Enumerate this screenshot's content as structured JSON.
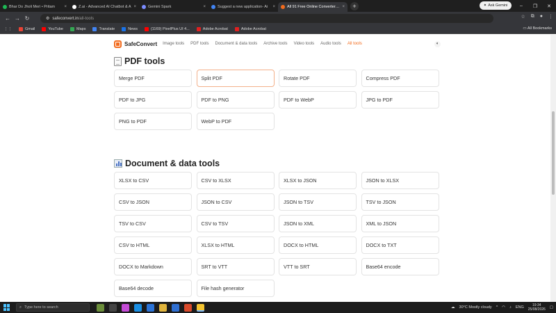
{
  "browser": {
    "tabs": [
      {
        "title": "Bhar Do Jholi Meri • Pritam",
        "favicon_color": "#1db954",
        "active": false
      },
      {
        "title": "Z.ai - Advanced AI Chatbot & A",
        "favicon_color": "#ffffff",
        "active": false
      },
      {
        "title": "Gemini Spark",
        "favicon_color": "#7b8cff",
        "active": false
      },
      {
        "title": "Suggest a new application- Ai",
        "favicon_color": "#4285f4",
        "active": false
      },
      {
        "title": "All 91 Free Online Converter To",
        "favicon_color": "#f26b1d",
        "active": true
      }
    ],
    "tab_close": "×",
    "new_tab": "+",
    "ask_gemini": "Ask Gemini",
    "window_controls": [
      "–",
      "❐",
      "✕"
    ],
    "url_domain": "safeconvert.in",
    "url_path": "/all-tools",
    "bookmarks": [
      {
        "label": "Gmail",
        "color": "#ea4335"
      },
      {
        "label": "YouTube",
        "color": "#ff0000"
      },
      {
        "label": "Maps",
        "color": "#34a853"
      },
      {
        "label": "Translate",
        "color": "#4285f4"
      },
      {
        "label": "News",
        "color": "#1a73e8"
      },
      {
        "label": "(1169) PixelPlus UI 4...",
        "color": "#ff0000"
      },
      {
        "label": "Adobe Acrobat",
        "color": "#e02020"
      },
      {
        "label": "Adobe Acrobat",
        "color": "#e02020"
      }
    ],
    "all_bookmarks": "All Bookmarks"
  },
  "site": {
    "brand": "SafeConvert",
    "brand_color": "#f26b1d",
    "nav": [
      "Image tools",
      "PDF tools",
      "Document & data tools",
      "Archive tools",
      "Video tools",
      "Audio tools",
      "All tools"
    ],
    "active_nav": "All tools",
    "theme_icon": "◐"
  },
  "sections": [
    {
      "title": "PDF tools",
      "icon": "document-icon",
      "tools": [
        "Merge PDF",
        "Split PDF",
        "Rotate PDF",
        "Compress PDF",
        "PDF to JPG",
        "PDF to PNG",
        "PDF to WebP",
        "JPG to PDF",
        "PNG to PDF",
        "WebP to PDF"
      ]
    },
    {
      "title": "Document & data tools",
      "icon": "bar-chart-icon",
      "tools": [
        "XLSX to CSV",
        "CSV to XLSX",
        "XLSX to JSON",
        "JSON to XLSX",
        "CSV to JSON",
        "JSON to CSV",
        "JSON to TSV",
        "TSV to JSON",
        "TSV to CSV",
        "CSV to TSV",
        "JSON to XML",
        "XML to JSON",
        "CSV to HTML",
        "XLSX to HTML",
        "DOCX to HTML",
        "DOCX to TXT",
        "DOCX to Markdown",
        "SRT to VTT",
        "VTT to SRT",
        "Base64 encode",
        "Base64 decode",
        "File hash generator"
      ]
    }
  ],
  "taskbar": {
    "search_placeholder": "Type here to search",
    "weather": "30°C  Mostly cloudy",
    "language": "ENG",
    "time": "19:34",
    "date": "25/08/2026"
  }
}
